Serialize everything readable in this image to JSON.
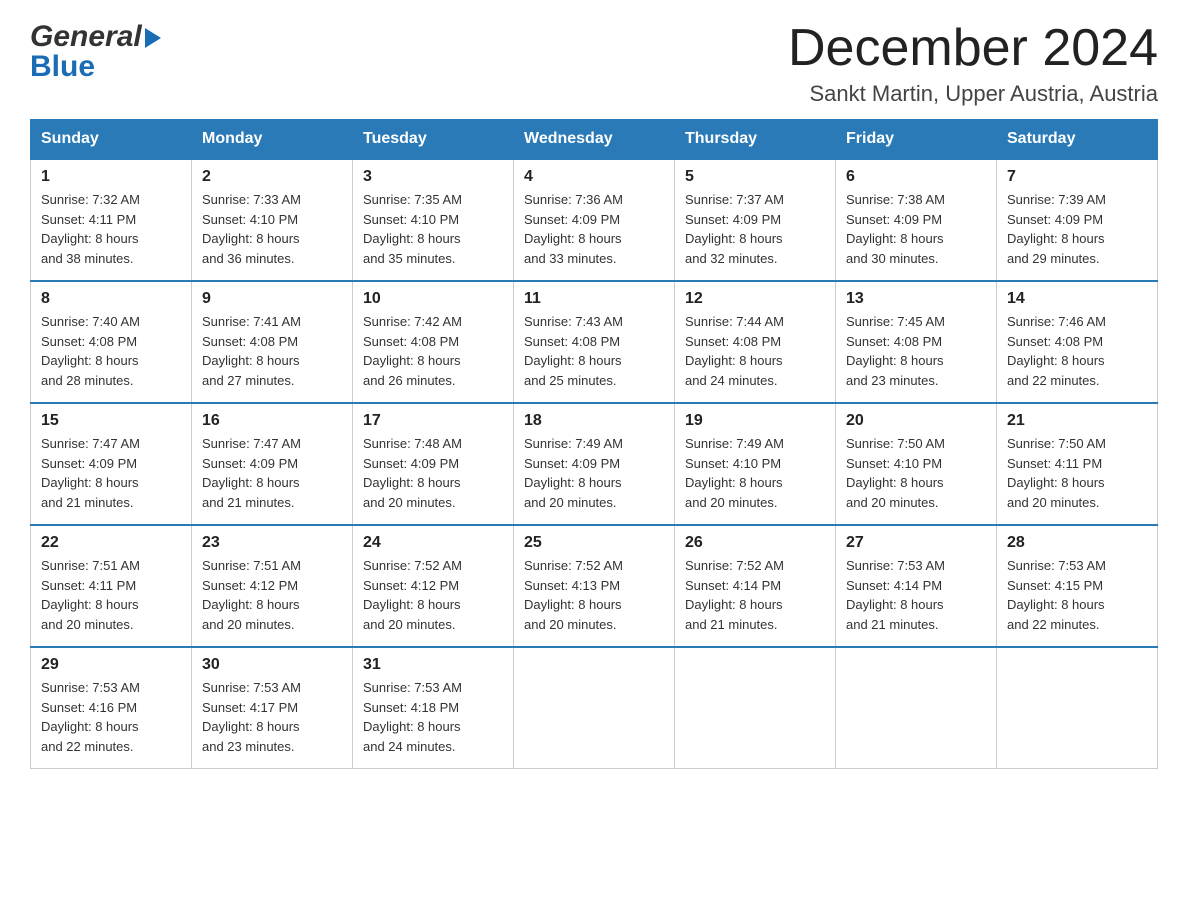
{
  "header": {
    "month_title": "December 2024",
    "location": "Sankt Martin, Upper Austria, Austria",
    "logo_line1": "General",
    "logo_line2": "Blue"
  },
  "columns": [
    "Sunday",
    "Monday",
    "Tuesday",
    "Wednesday",
    "Thursday",
    "Friday",
    "Saturday"
  ],
  "weeks": [
    [
      {
        "day": "1",
        "sunrise": "7:32 AM",
        "sunset": "4:11 PM",
        "daylight": "8 hours and 38 minutes."
      },
      {
        "day": "2",
        "sunrise": "7:33 AM",
        "sunset": "4:10 PM",
        "daylight": "8 hours and 36 minutes."
      },
      {
        "day": "3",
        "sunrise": "7:35 AM",
        "sunset": "4:10 PM",
        "daylight": "8 hours and 35 minutes."
      },
      {
        "day": "4",
        "sunrise": "7:36 AM",
        "sunset": "4:09 PM",
        "daylight": "8 hours and 33 minutes."
      },
      {
        "day": "5",
        "sunrise": "7:37 AM",
        "sunset": "4:09 PM",
        "daylight": "8 hours and 32 minutes."
      },
      {
        "day": "6",
        "sunrise": "7:38 AM",
        "sunset": "4:09 PM",
        "daylight": "8 hours and 30 minutes."
      },
      {
        "day": "7",
        "sunrise": "7:39 AM",
        "sunset": "4:09 PM",
        "daylight": "8 hours and 29 minutes."
      }
    ],
    [
      {
        "day": "8",
        "sunrise": "7:40 AM",
        "sunset": "4:08 PM",
        "daylight": "8 hours and 28 minutes."
      },
      {
        "day": "9",
        "sunrise": "7:41 AM",
        "sunset": "4:08 PM",
        "daylight": "8 hours and 27 minutes."
      },
      {
        "day": "10",
        "sunrise": "7:42 AM",
        "sunset": "4:08 PM",
        "daylight": "8 hours and 26 minutes."
      },
      {
        "day": "11",
        "sunrise": "7:43 AM",
        "sunset": "4:08 PM",
        "daylight": "8 hours and 25 minutes."
      },
      {
        "day": "12",
        "sunrise": "7:44 AM",
        "sunset": "4:08 PM",
        "daylight": "8 hours and 24 minutes."
      },
      {
        "day": "13",
        "sunrise": "7:45 AM",
        "sunset": "4:08 PM",
        "daylight": "8 hours and 23 minutes."
      },
      {
        "day": "14",
        "sunrise": "7:46 AM",
        "sunset": "4:08 PM",
        "daylight": "8 hours and 22 minutes."
      }
    ],
    [
      {
        "day": "15",
        "sunrise": "7:47 AM",
        "sunset": "4:09 PM",
        "daylight": "8 hours and 21 minutes."
      },
      {
        "day": "16",
        "sunrise": "7:47 AM",
        "sunset": "4:09 PM",
        "daylight": "8 hours and 21 minutes."
      },
      {
        "day": "17",
        "sunrise": "7:48 AM",
        "sunset": "4:09 PM",
        "daylight": "8 hours and 20 minutes."
      },
      {
        "day": "18",
        "sunrise": "7:49 AM",
        "sunset": "4:09 PM",
        "daylight": "8 hours and 20 minutes."
      },
      {
        "day": "19",
        "sunrise": "7:49 AM",
        "sunset": "4:10 PM",
        "daylight": "8 hours and 20 minutes."
      },
      {
        "day": "20",
        "sunrise": "7:50 AM",
        "sunset": "4:10 PM",
        "daylight": "8 hours and 20 minutes."
      },
      {
        "day": "21",
        "sunrise": "7:50 AM",
        "sunset": "4:11 PM",
        "daylight": "8 hours and 20 minutes."
      }
    ],
    [
      {
        "day": "22",
        "sunrise": "7:51 AM",
        "sunset": "4:11 PM",
        "daylight": "8 hours and 20 minutes."
      },
      {
        "day": "23",
        "sunrise": "7:51 AM",
        "sunset": "4:12 PM",
        "daylight": "8 hours and 20 minutes."
      },
      {
        "day": "24",
        "sunrise": "7:52 AM",
        "sunset": "4:12 PM",
        "daylight": "8 hours and 20 minutes."
      },
      {
        "day": "25",
        "sunrise": "7:52 AM",
        "sunset": "4:13 PM",
        "daylight": "8 hours and 20 minutes."
      },
      {
        "day": "26",
        "sunrise": "7:52 AM",
        "sunset": "4:14 PM",
        "daylight": "8 hours and 21 minutes."
      },
      {
        "day": "27",
        "sunrise": "7:53 AM",
        "sunset": "4:14 PM",
        "daylight": "8 hours and 21 minutes."
      },
      {
        "day": "28",
        "sunrise": "7:53 AM",
        "sunset": "4:15 PM",
        "daylight": "8 hours and 22 minutes."
      }
    ],
    [
      {
        "day": "29",
        "sunrise": "7:53 AM",
        "sunset": "4:16 PM",
        "daylight": "8 hours and 22 minutes."
      },
      {
        "day": "30",
        "sunrise": "7:53 AM",
        "sunset": "4:17 PM",
        "daylight": "8 hours and 23 minutes."
      },
      {
        "day": "31",
        "sunrise": "7:53 AM",
        "sunset": "4:18 PM",
        "daylight": "8 hours and 24 minutes."
      },
      null,
      null,
      null,
      null
    ]
  ],
  "labels": {
    "sunrise_prefix": "Sunrise: ",
    "sunset_prefix": "Sunset: ",
    "daylight_prefix": "Daylight: "
  }
}
